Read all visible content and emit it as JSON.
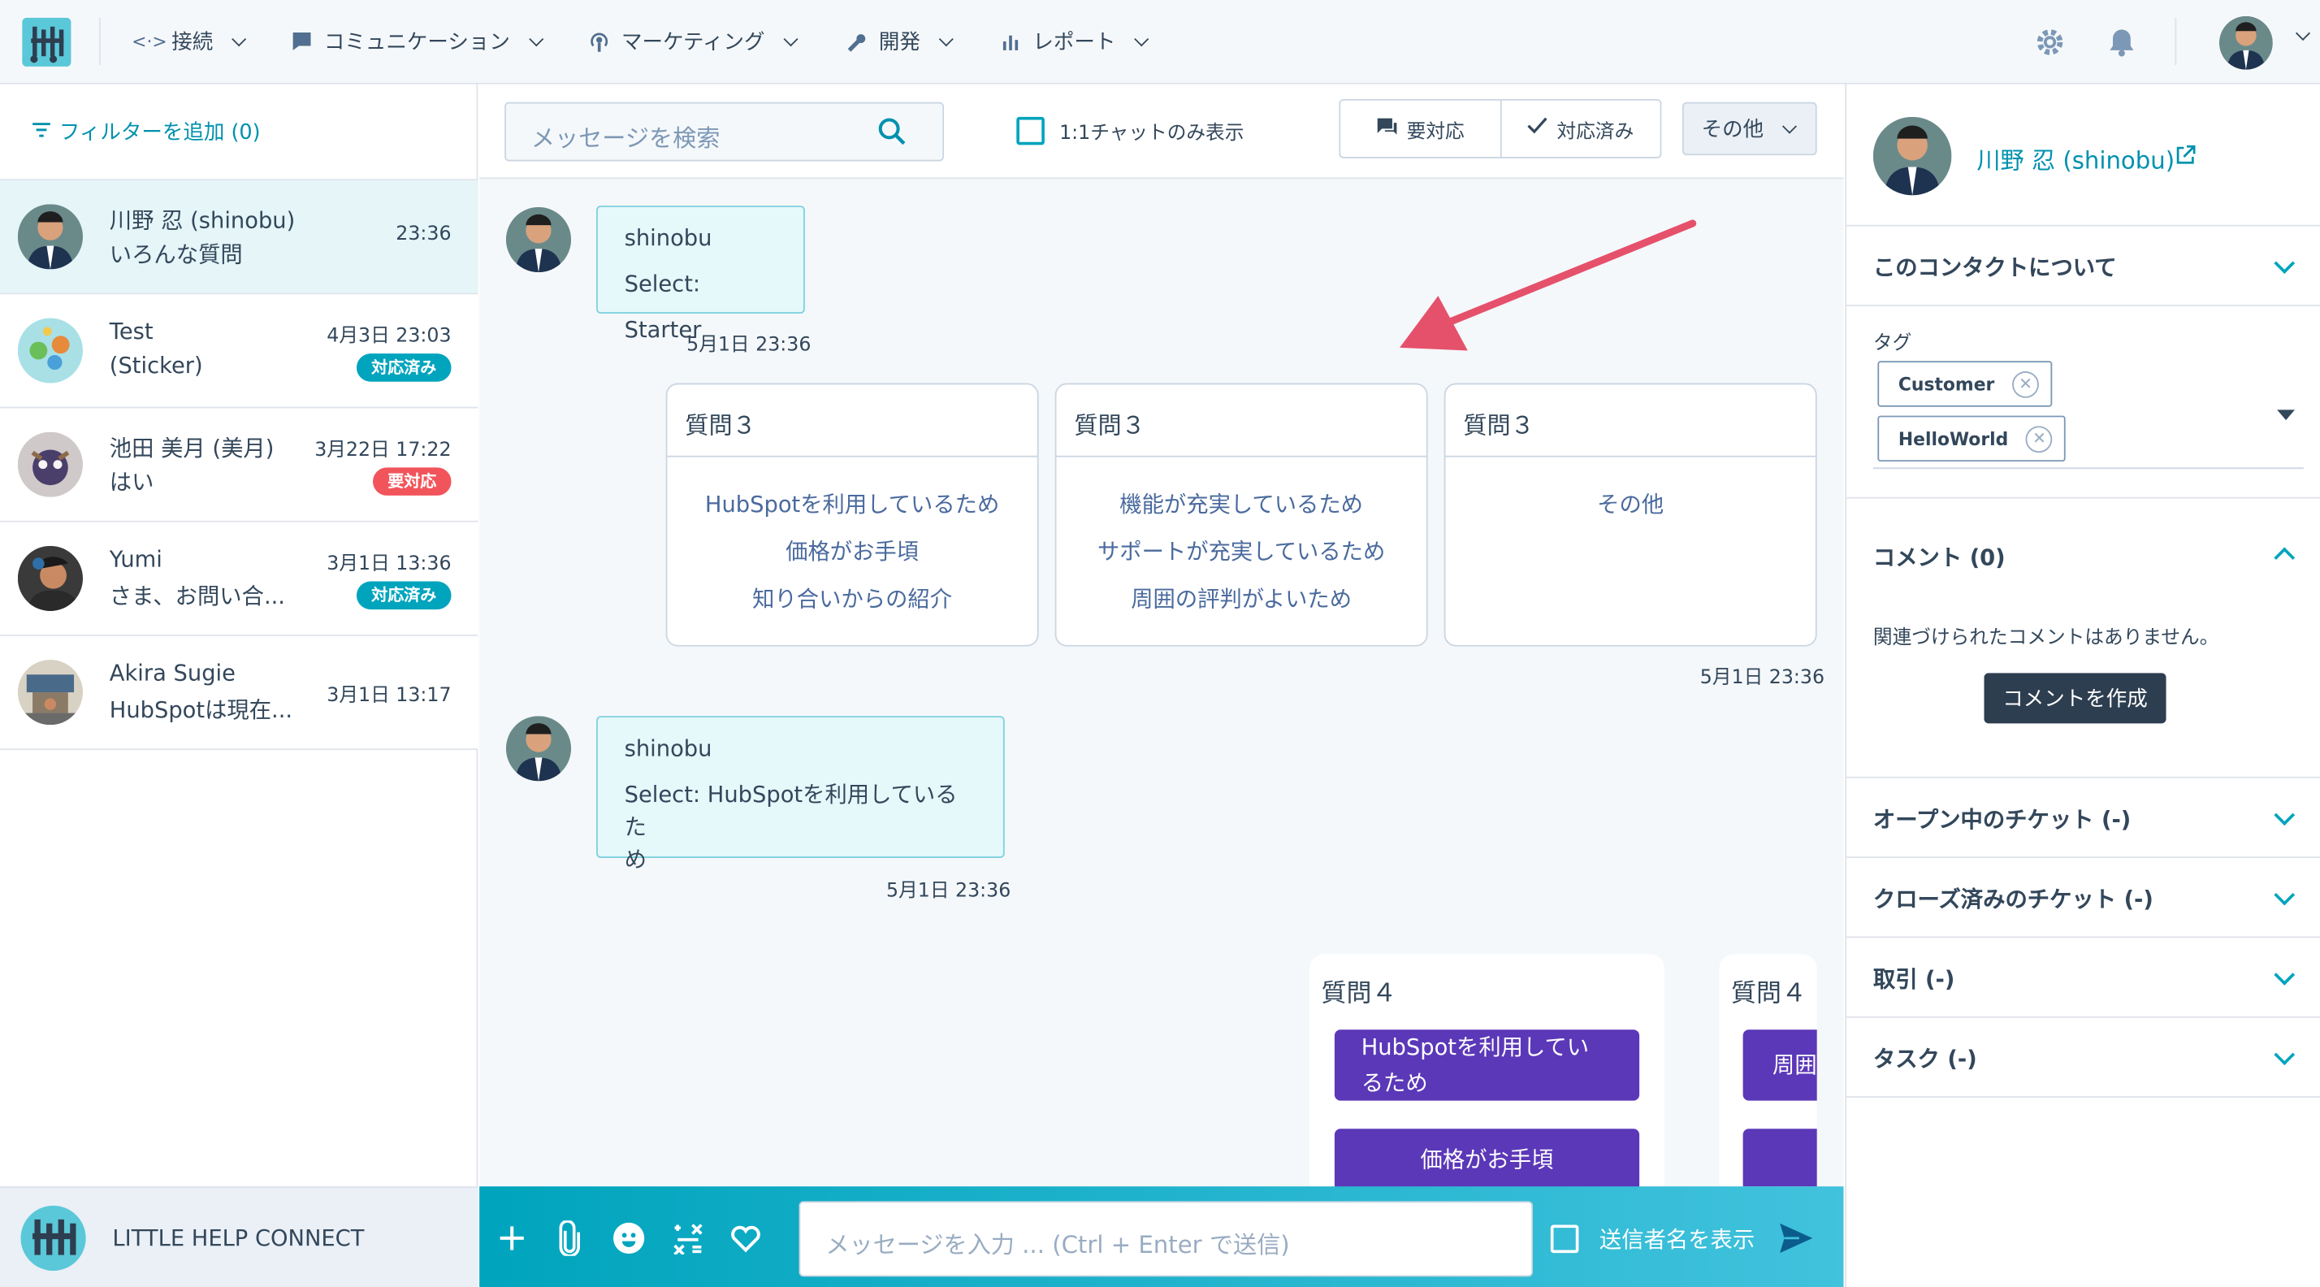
{
  "nav": {
    "items": [
      {
        "label": "接続",
        "icon": "connect-icon"
      },
      {
        "label": "コミュニケーション",
        "icon": "chat-icon"
      },
      {
        "label": "マーケティング",
        "icon": "broadcast-icon"
      },
      {
        "label": "開発",
        "icon": "wrench-icon"
      },
      {
        "label": "レポート",
        "icon": "bar-chart-icon"
      }
    ],
    "right_icons": [
      "gear-icon",
      "bell-icon",
      "avatar"
    ]
  },
  "sidebar": {
    "filter_label": "フィルターを追加 (0)",
    "conversations": [
      {
        "name": "川野 忍 (shinobu)",
        "message": "いろんな質問",
        "time": "23:36",
        "badge": "",
        "selected": true
      },
      {
        "name": "Test",
        "message": "(Sticker)",
        "time": "4月3日 23:03",
        "badge": "対応済み",
        "badge_type": "done"
      },
      {
        "name": "池田 美月 (美月)",
        "message": "はい",
        "time": "3月22日 17:22",
        "badge": "要対応",
        "badge_type": "need"
      },
      {
        "name": "Yumi",
        "message": "さま、お問い合...",
        "time": "3月1日 13:36",
        "badge": "対応済み",
        "badge_type": "done"
      },
      {
        "name": "Akira Sugie",
        "message": "HubSpotは現在...",
        "time": "3月1日 13:17",
        "badge": ""
      }
    ],
    "brand": "LITTLE HELP CONNECT"
  },
  "toolbar": {
    "search_placeholder": "メッセージを検索",
    "only_chat_label": "1:1チャットのみ表示",
    "need_label": "要対応",
    "done_label": "対応済み",
    "other_label": "その他"
  },
  "chat": {
    "msg1": {
      "sender": "shinobu",
      "text": "Select: Starter",
      "time": "5月1日 23:36"
    },
    "carousel1": {
      "time": "5月1日 23:36",
      "cards": [
        {
          "title": "質問３",
          "items": [
            "HubSpotを利用しているため",
            "価格がお手頃",
            "知り合いからの紹介"
          ]
        },
        {
          "title": "質問３",
          "items": [
            "機能が充実しているため",
            "サポートが充実しているため",
            "周囲の評判がよいため"
          ]
        },
        {
          "title": "質問３",
          "items": [
            "その他"
          ]
        }
      ]
    },
    "msg2": {
      "sender": "shinobu",
      "text1": "Select: HubSpotを利用しているた",
      "text2": "め",
      "time": "5月1日 23:36"
    },
    "carousel2": {
      "cards": [
        {
          "title": "質問４",
          "btn1a": "HubSpotを利用してい",
          "btn1b": "るため",
          "btn2": "価格がお手頃"
        },
        {
          "title": "質問４",
          "btn1": "周囲"
        }
      ]
    }
  },
  "composer": {
    "placeholder": "メッセージを入力 ... (Ctrl + Enter で送信)",
    "sender_label": "送信者名を表示"
  },
  "contact": {
    "name": "川野 忍 (shinobu)",
    "about_label": "このコンタクトについて",
    "tag_label": "タグ",
    "tags": [
      "Customer",
      "HelloWorld"
    ],
    "comments_label": "コメント (0)",
    "no_comments": "関連づけられたコメントはありません。",
    "create_comment": "コメントを作成",
    "open_tickets": "オープン中のチケット (-)",
    "closed_tickets": "クローズ済みのチケット (-)",
    "deals": "取引 (-)",
    "tasks": "タスク (-)"
  },
  "colors": {
    "accent": "#00a4bd",
    "purple": "#5b38b8",
    "need": "#f2545b",
    "arrow": "#e5516b"
  }
}
